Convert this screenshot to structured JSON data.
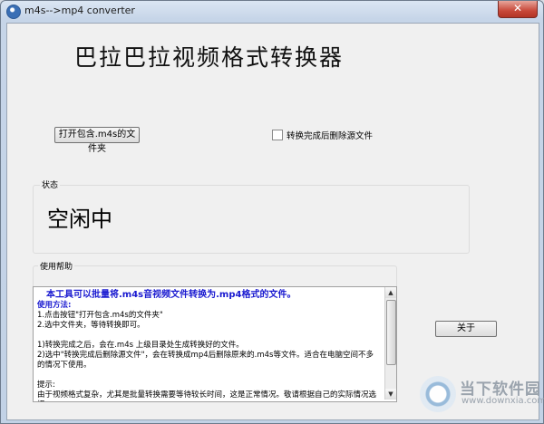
{
  "window": {
    "title": "m4s-->mp4 converter",
    "close_label": "✕"
  },
  "heading": "巴拉巴拉视频格式转换器",
  "open_button": "打开包含.m4s的文件夹",
  "delete_checkbox": {
    "label": "转换完成后删除源文件",
    "checked": false
  },
  "status": {
    "caption": "状态",
    "value": "空闲中"
  },
  "help": {
    "caption": "使用帮助",
    "headline": "本工具可以批量将.m4s音视频文件转换为.mp4格式的文件。",
    "usage_title": "使用方法:",
    "lines": [
      "1.点击按钮\"打开包含.m4s的文件夹\"",
      "2.选中文件夹，等待转换即可。",
      "",
      "1)转换完成之后，会在.m4s 上级目录处生成转换好的文件。",
      "2)选中\"转换完成后删除源文件\"，会在转换成mp4后删除原来的.m4s等文件。适合在电脑空间不多的情况下使用。",
      "",
      "提示:",
      "由于视频格式复杂，尤其是批量转换需要等待较长时间，这是正常情况。敬请根据自己的实际情况选择。"
    ]
  },
  "about_button": "关于",
  "watermark": {
    "text": "当下软件园",
    "url": "www.downxia.com"
  }
}
